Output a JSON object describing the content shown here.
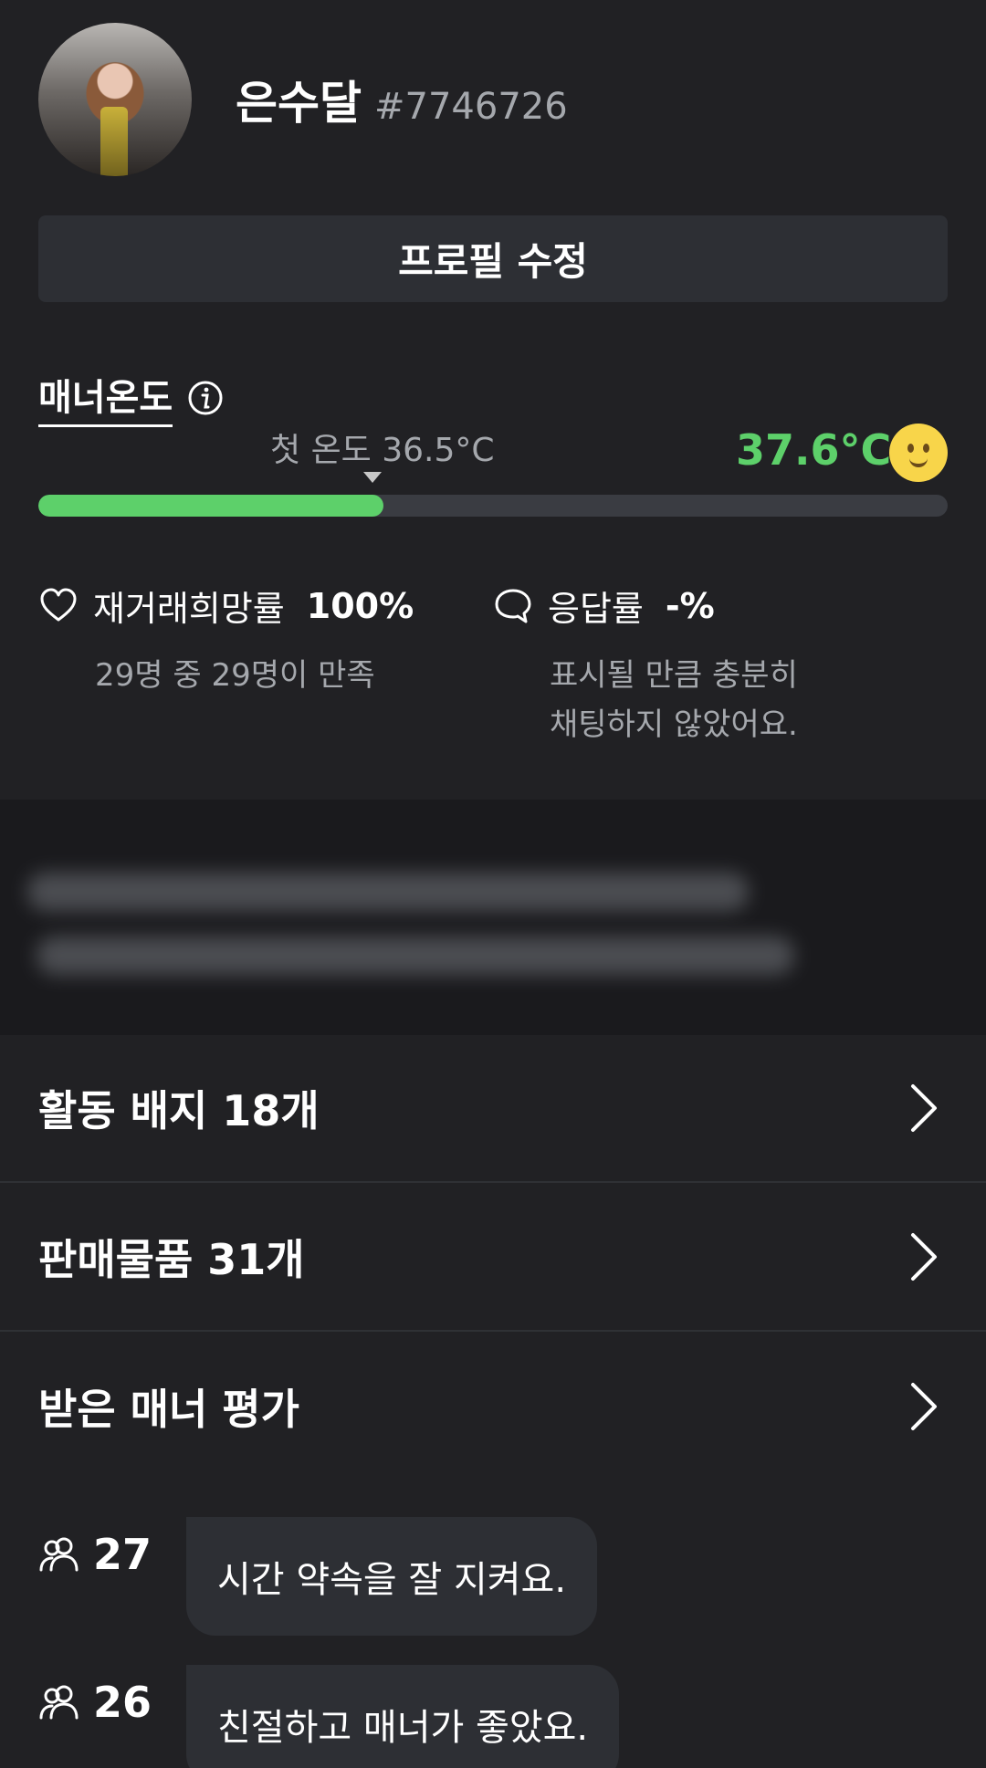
{
  "profile": {
    "nickname": "은수달",
    "user_id": "#7746726",
    "edit_button_label": "프로필 수정"
  },
  "manner": {
    "title": "매너온도",
    "first_temperature_label": "첫 온도 36.5°C",
    "current_temperature": "37.6°C",
    "temperature_fraction": 0.38,
    "accent_color": "#5dd06a"
  },
  "stats": {
    "rehire": {
      "label": "재거래희망률",
      "value": "100%",
      "description": "29명 중 29명이 만족"
    },
    "response": {
      "label": "응답률",
      "value": "-%",
      "description": "표시될 만큼 충분히\n채팅하지 않았어요."
    }
  },
  "menu": {
    "badges": "활동 배지 18개",
    "products": "판매물품 31개",
    "reviews": "받은 매너 평가"
  },
  "manner_reviews": [
    {
      "count": "27",
      "text": "시간 약속을 잘 지켜요."
    },
    {
      "count": "26",
      "text": "친절하고 매너가 좋았요."
    }
  ],
  "icons": {
    "info": "info-icon",
    "heart": "heart-icon",
    "chat": "chat-bubble-icon",
    "chevron": "chevron-right-icon",
    "people": "people-icon",
    "emoji": "smiley-face-icon"
  }
}
